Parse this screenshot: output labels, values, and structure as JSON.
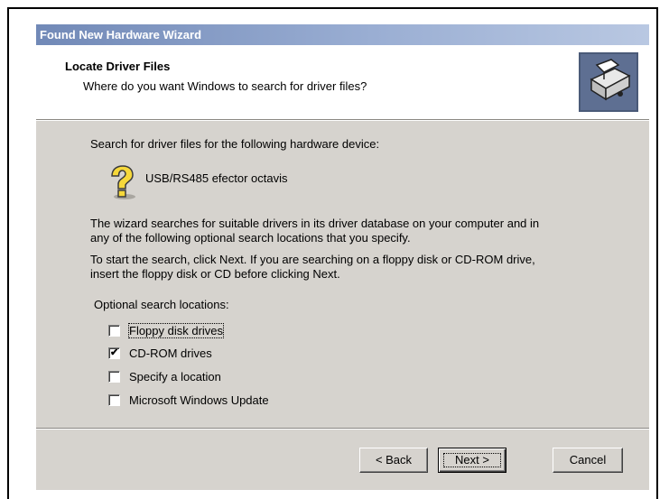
{
  "window": {
    "title": "Found New Hardware Wizard"
  },
  "header": {
    "title": "Locate Driver Files",
    "subtitle": "Where do you want Windows to search for driver files?",
    "icon": "hardware-wizard-icon"
  },
  "body": {
    "intro": "Search for driver files for the following hardware device:",
    "device_name": "USB/RS485 efector octavis",
    "device_icon": "unknown-device-question-icon",
    "para1_line1": "The wizard searches for suitable drivers in its driver database on your computer and in",
    "para1_line2": "any of the following optional search locations that you specify.",
    "para2_line1": "To start the search, click Next. If you are searching on a floppy disk or CD-ROM drive,",
    "para2_line2": "insert the floppy disk or CD before clicking Next.",
    "locations_label": "Optional search locations:"
  },
  "options": [
    {
      "label": "Floppy disk drives",
      "accel": "d",
      "checked": false
    },
    {
      "label": "CD-ROM drives",
      "accel": "C",
      "checked": true
    },
    {
      "label": "Specify a location",
      "accel": "S",
      "checked": false
    },
    {
      "label": "Microsoft Windows Update",
      "accel": "M",
      "checked": false
    }
  ],
  "buttons": {
    "back": "< Back",
    "next": "Next >",
    "cancel": "Cancel"
  }
}
